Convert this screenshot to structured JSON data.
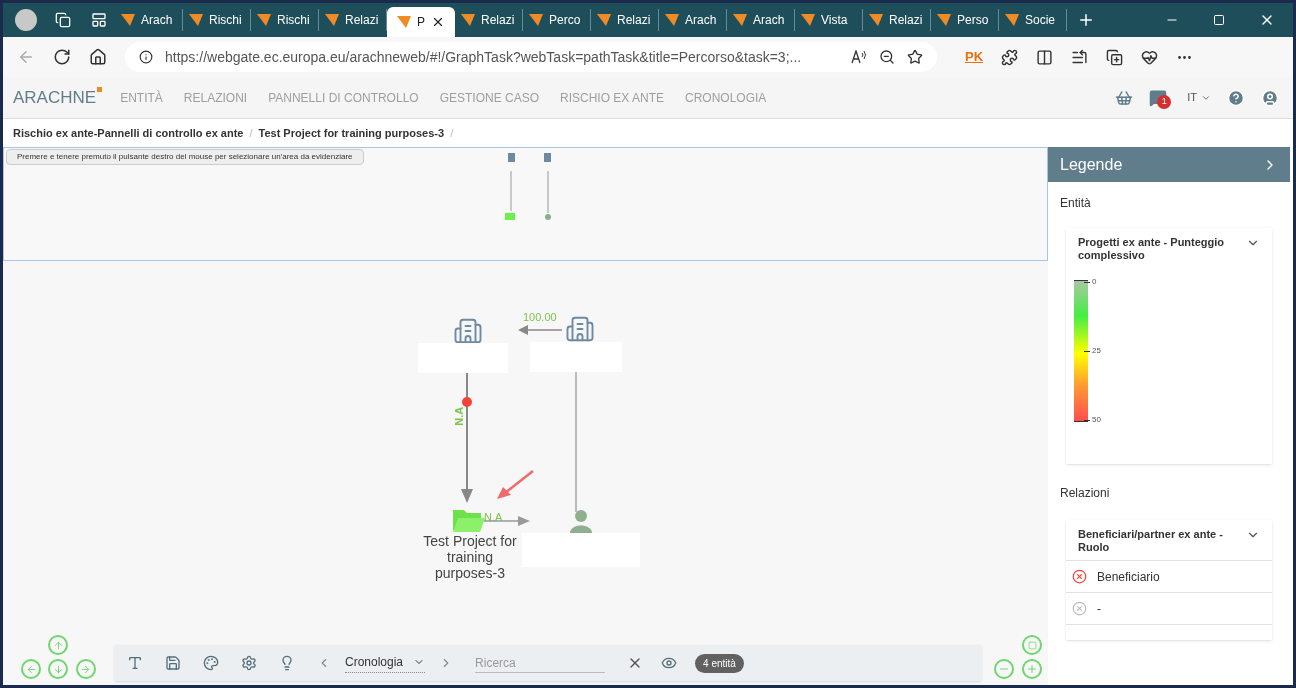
{
  "browser": {
    "tabs": [
      {
        "label": "Arach",
        "selected": false
      },
      {
        "label": "Rischi",
        "selected": false
      },
      {
        "label": "Rischi",
        "selected": false
      },
      {
        "label": "Relazi",
        "selected": false
      },
      {
        "label": "P",
        "selected": true
      },
      {
        "label": "Relazi",
        "selected": false
      },
      {
        "label": "Perco",
        "selected": false
      },
      {
        "label": "Relazi",
        "selected": false
      },
      {
        "label": "Arach",
        "selected": false
      },
      {
        "label": "Arach",
        "selected": false
      },
      {
        "label": "Vista",
        "selected": false
      },
      {
        "label": "Relazi",
        "selected": false
      },
      {
        "label": "Perso",
        "selected": false
      },
      {
        "label": "Socie",
        "selected": false
      }
    ],
    "address": "https://webgate.ec.europa.eu/arachneweb/#!/GraphTask?webTask=pathTask&title=Percorso&task=3;...",
    "profile_badge": "PK"
  },
  "app": {
    "logo": "ARACHNE",
    "nav": [
      "ENTITÀ",
      "RELAZIONI",
      "PANNELLI DI CONTROLLO",
      "GESTIONE CASO",
      "RISCHIO EX ANTE",
      "CRONOLOGIA"
    ],
    "notification_count": "1",
    "language": "IT"
  },
  "breadcrumb_separator": "/",
  "breadcrumb": [
    "Rischio ex ante-Pannelli di controllo ex ante",
    "Test Project for training purposes-3"
  ],
  "hint": "Premere e tenere premuto il pulsante destro del mouse per selezionare un'area da evidenziare",
  "graph": {
    "edge_amount": "100.00",
    "edge_role": "N.A",
    "edge_project": "N.A",
    "project_label": "Test Project for training purposes-3"
  },
  "toolbar": {
    "timeline": "Cronologia",
    "search_placeholder": "Ricerca",
    "count": "4 entità"
  },
  "legend": {
    "title": "Legende",
    "entities_heading": "Entità",
    "entities_card": {
      "title": "Progetti ex ante - Punteggio complessivo",
      "ticks": [
        "0",
        "25",
        "50"
      ]
    },
    "relations_heading": "Relazioni",
    "relations_card": {
      "title": "Beneficiari/partner ex ante - Ruolo",
      "items": [
        {
          "label": "Beneficiario",
          "color": "#f44336"
        },
        {
          "label": "-",
          "color": "#bdbdbd"
        }
      ]
    }
  }
}
